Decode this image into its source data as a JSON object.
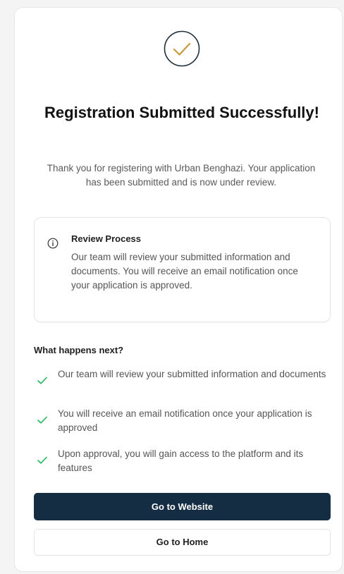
{
  "status": {
    "title": "Registration Submitted Successfully!",
    "message": "Thank you for registering with Urban Benghazi. Your application has been submitted and is now under review.",
    "icon": "check-circle-icon",
    "accent_color": "#c79a3b"
  },
  "review": {
    "title": "Review Process",
    "text": "Our team will review your submitted information and documents. You will receive an email notification once your application is approved.",
    "icon": "info-icon"
  },
  "next_steps": {
    "title": "What happens next?",
    "items": [
      {
        "text": "Our team will review your submitted information and documents"
      },
      {
        "text": "You will receive an email notification once your application is approved"
      },
      {
        "text": "Upon approval, you will gain access to the platform and its features"
      }
    ],
    "check_color": "#22b45a"
  },
  "actions": {
    "primary_label": "Go to Website",
    "secondary_label": "Go to Home",
    "primary_color": "#142d43"
  }
}
